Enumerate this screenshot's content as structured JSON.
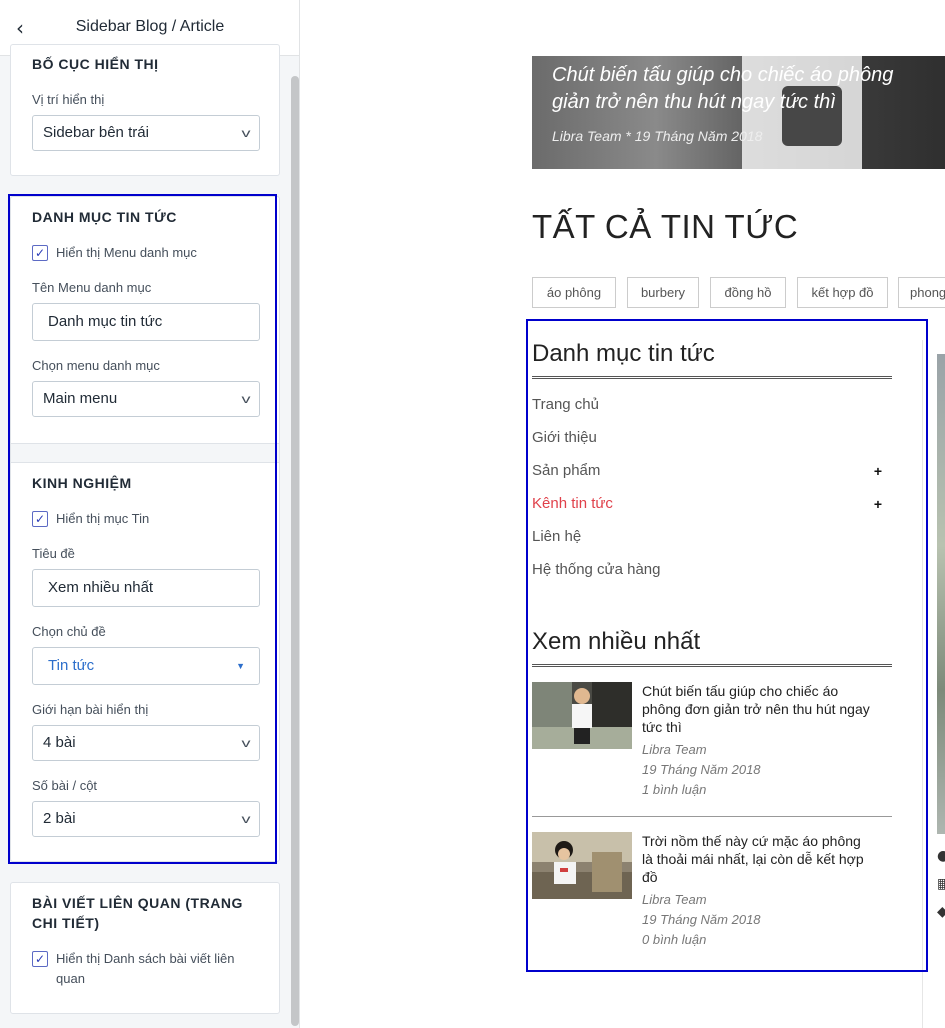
{
  "panel": {
    "title": "Sidebar Blog / Article",
    "back_icon": "chevron-left-icon",
    "layout_section": {
      "heading": "BỐ CỤC HIỂN THỊ",
      "position_label": "Vị trí hiển thị",
      "position_value": "Sidebar bên trái"
    },
    "category_section": {
      "heading": "DANH MỤC TIN TỨC",
      "show_menu_label": "Hiển thị Menu danh mục",
      "show_menu_checked": true,
      "menu_name_label": "Tên Menu danh mục",
      "menu_name_value": "Danh mục tin tức",
      "choose_menu_label": "Chọn menu danh mục",
      "choose_menu_value": "Main menu"
    },
    "experience_section": {
      "heading": "KINH NGHIỆM",
      "show_item_label": "Hiển thị mục Tin",
      "show_item_checked": true,
      "title_label": "Tiêu đề",
      "title_value": "Xem nhiều nhất",
      "topic_label": "Chọn chủ đề",
      "topic_value": "Tin tức",
      "limit_label": "Giới hạn bài hiển thị",
      "limit_value": "4 bài",
      "per_column_label": "Số bài / cột",
      "per_column_value": "2 bài"
    },
    "related_section": {
      "heading": "BÀI VIẾT LIÊN QUAN (TRANG CHI TIẾT)",
      "show_related_label": "Hiển thị Danh sách bài viết liên quan",
      "show_related_checked": true
    },
    "highlight_color": "#0000cc"
  },
  "preview": {
    "hero": {
      "title_line1": "Chút biến tấu giúp cho chiếc áo phông",
      "title_line2": "giản trở nên thu hút ngay tức thì",
      "meta": "Libra Team *  19 Tháng Năm 2018"
    },
    "heading": "TẤT CẢ TIN TỨC",
    "tags": [
      "áo phông",
      "burbery",
      "đồng hồ",
      "kết hợp đồ",
      "phong"
    ],
    "sidebar": {
      "category_heading": "Danh mục tin tức",
      "menu": [
        {
          "label": "Trang chủ",
          "has_children": false,
          "active": false
        },
        {
          "label": "Giới thiệu",
          "has_children": false,
          "active": false
        },
        {
          "label": "Sản phẩm",
          "has_children": true,
          "active": false
        },
        {
          "label": "Kênh tin tức",
          "has_children": true,
          "active": true
        },
        {
          "label": "Liên hệ",
          "has_children": false,
          "active": false
        },
        {
          "label": "Hệ thống cửa hàng",
          "has_children": false,
          "active": false
        }
      ],
      "expand_symbol": "+",
      "most_viewed_heading": "Xem nhiều nhất",
      "posts": [
        {
          "title": "Chút biến tấu giúp cho chiếc áo phông đơn giản trở nên thu hút ngay tức thì",
          "author": "Libra Team",
          "date": "19 Tháng Năm 2018",
          "comments": "1 bình luận"
        },
        {
          "title": "Trời nồm thế này cứ mặc áo phông là thoải mái nhất, lại còn dễ kết hợp đồ",
          "author": "Libra Team",
          "date": "19 Tháng Năm 2018",
          "comments": "0 bình luận"
        }
      ]
    },
    "accent_color": "#e0414b"
  }
}
